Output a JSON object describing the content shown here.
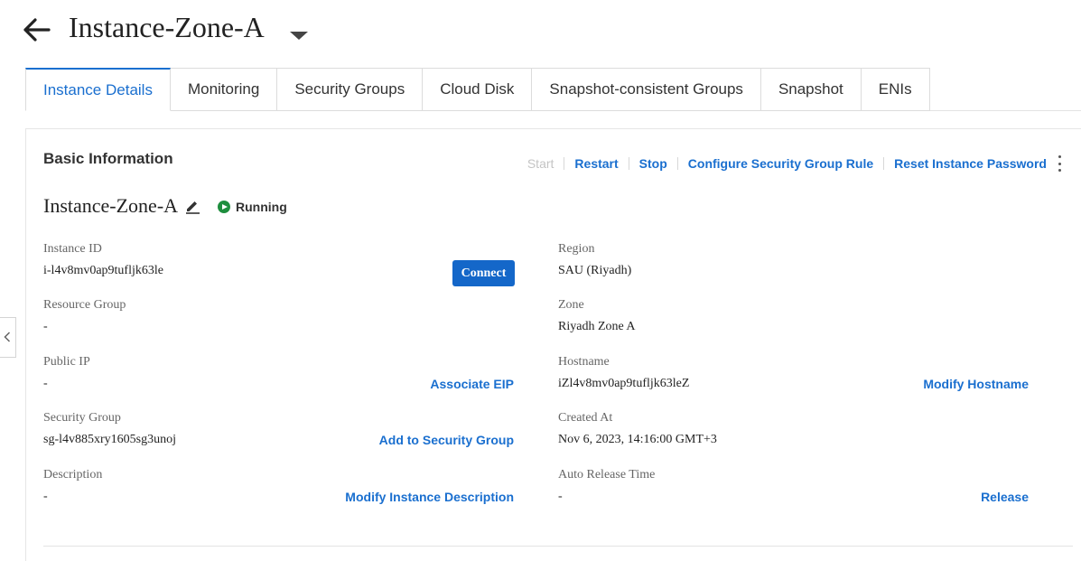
{
  "header": {
    "title": "Instance-Zone-A"
  },
  "tabs": [
    {
      "label": "Instance Details"
    },
    {
      "label": "Monitoring"
    },
    {
      "label": "Security Groups"
    },
    {
      "label": "Cloud Disk"
    },
    {
      "label": "Snapshot-consistent Groups"
    },
    {
      "label": "Snapshot"
    },
    {
      "label": "ENIs"
    }
  ],
  "section": {
    "title": "Basic Information"
  },
  "actions": {
    "start": "Start",
    "restart": "Restart",
    "stop": "Stop",
    "configure_sg": "Configure Security Group Rule",
    "reset_password": "Reset Instance Password"
  },
  "instance": {
    "name": "Instance-Zone-A",
    "status": "Running",
    "status_color": "#1e8e3e"
  },
  "fields": {
    "instance_id": {
      "label": "Instance ID",
      "value": "i-l4v8mv0ap9tufljk63le",
      "action": "Connect"
    },
    "resource_group": {
      "label": "Resource Group",
      "value": "-"
    },
    "public_ip": {
      "label": "Public IP",
      "value": "-",
      "action": "Associate EIP"
    },
    "security_group": {
      "label": "Security Group",
      "value": "sg-l4v885xry1605sg3unoj",
      "action": "Add to Security Group"
    },
    "description": {
      "label": "Description",
      "value": "-",
      "action": "Modify Instance Description"
    },
    "region": {
      "label": "Region",
      "value": "SAU (Riyadh)"
    },
    "zone": {
      "label": "Zone",
      "value": "Riyadh Zone A"
    },
    "hostname": {
      "label": "Hostname",
      "value": "iZl4v8mv0ap9tufljk63leZ",
      "action": "Modify Hostname"
    },
    "created_at": {
      "label": "Created At",
      "value": "Nov 6, 2023, 14:16:00 GMT+3"
    },
    "auto_release": {
      "label": "Auto Release Time",
      "value": "-",
      "action": "Release"
    }
  },
  "colors": {
    "accent": "#1a6fcf",
    "primary_button": "#1467c9"
  }
}
